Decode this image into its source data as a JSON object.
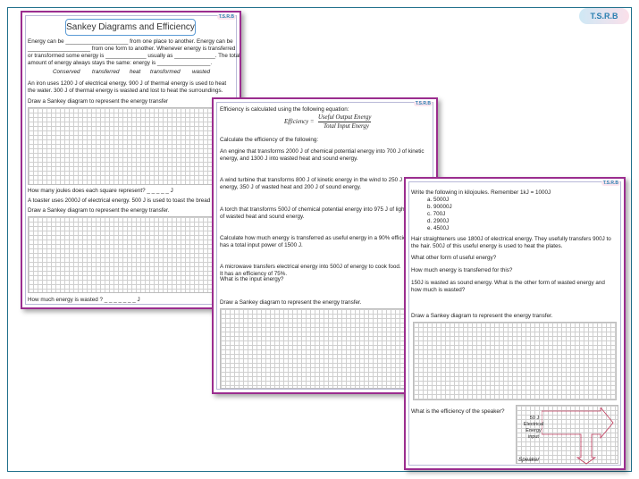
{
  "logo": {
    "text": "T.S.R.B"
  },
  "sheet1": {
    "title": "Sankey Diagrams and Efficiency",
    "para_lines": [
      "Energy can be ____________________ from one place to another. Energy can be",
      "____________________ from one form to another. Whenever energy is transferred",
      "or transformed some energy is _____________ usually as _____________. The total",
      "amount of energy always stays the same: energy is _________________."
    ],
    "word_bank": [
      "Conserved",
      "transferred",
      "heat",
      "transformed",
      "wasted"
    ],
    "iron_lines": [
      "An iron uses 1200 J of electrical energy. 900 J of thermal energy is used to heat",
      "the water. 300 J of thermal energy is wasted and lost to heat the surroundings."
    ],
    "draw1": "Draw a Sankey diagram to represent the energy transfer",
    "square_q": "How many joules does each square represent? _ _ _ _ _ J",
    "toaster": "A toaster uses 2000J of electrical energy. 500 J is used to toast the bread",
    "draw2": "Draw a Sankey diagram to represent the energy transfer.",
    "wasted_q": "How much energy is wasted ? _ _ _ _ _ _ _  J"
  },
  "sheet2": {
    "intro": "Efficiency is calculated using the following equation:",
    "formula_lhs": "Efficiency =",
    "formula_num": "Useful Output Energy",
    "formula_den": "Total Input Energy",
    "calc": "Calculate the efficiency of the following:",
    "q_engine": [
      "An engine that transforms 2000 J of chemical potential energy into 700 J of kinetic",
      "energy, and 1300 J into wasted heat and sound energy."
    ],
    "q_turbine": [
      "A wind turbine that transforms 800 J of kinetic energy in the wind to 250 J of",
      "energy, 350 J of wasted heat and 200 J of sound energy."
    ],
    "q_torch": [
      "A torch that transforms 500J of chemical potential energy into 975 J of light, a",
      "of wasted heat and sound energy."
    ],
    "q_useful": [
      "Calculate how much energy is transferred as useful energy in a 90% efficient k",
      "has a total input power of 1500 J."
    ],
    "q_microwave": [
      "A microwave transfers electrical energy into 500J of energy to cook food.",
      "It has an efficiency of 75%.",
      "What is the input energy?"
    ],
    "draw": "Draw a Sankey diagram to represent the energy transfer."
  },
  "sheet3": {
    "kj_q": "Write the following in kilojoules. Remember 1kJ = 1000J",
    "kj_items": [
      "a.   5000J",
      "b.   90000J",
      "c.   700J",
      "d.   2900J",
      "e.   4500J"
    ],
    "hair": [
      "Hair straighteners use 1800J of electrical energy. They usefully transfers 900J to",
      "the hair. 500J of this useful energy is used to heat the plates."
    ],
    "other_form": "What other form of useful energy?",
    "how_much": "How much energy is transferred for this?",
    "wasted_sound": [
      "150J is wasted as sound energy. What is the other form of wasted energy and",
      "how much is wasted?"
    ],
    "draw": "Draw a Sankey diagram to represent the energy transfer.",
    "speaker_q": "What is the efficiency of the speaker?",
    "input_label": [
      "50 J",
      "Electrical",
      "Energy",
      "input"
    ],
    "speaker_label": "Speaker"
  }
}
